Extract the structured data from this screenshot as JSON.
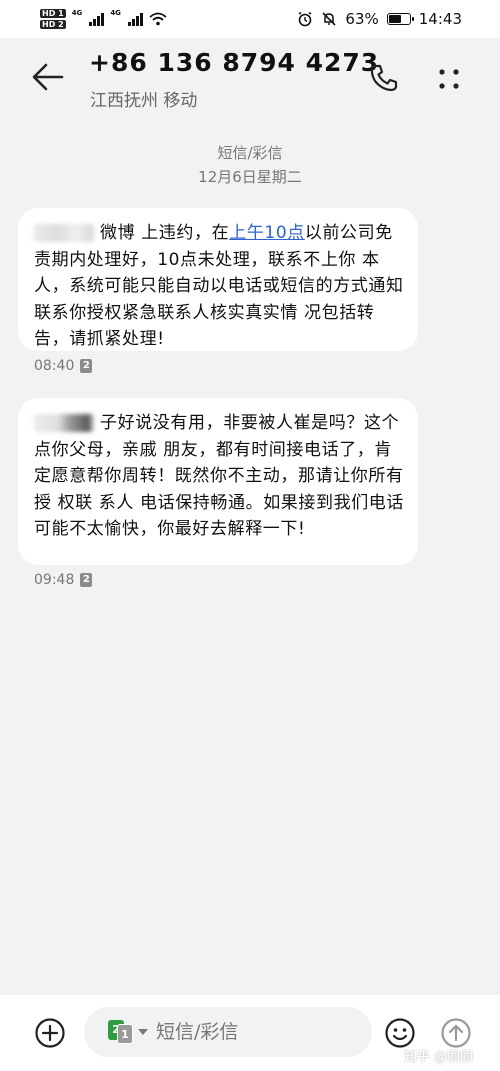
{
  "status_bar": {
    "hd_badge_1": "HD 1",
    "hd_badge_2": "HD 2",
    "network_1": "4G",
    "network_2": "4G",
    "battery_text": "63%",
    "battery_level": 0.63,
    "time": "14:43",
    "icons": [
      "hd-icon",
      "signal-icon",
      "wifi-icon",
      "alarm-icon",
      "mute-icon",
      "battery-icon"
    ]
  },
  "header": {
    "contact_number": "+86 136 8794 4273",
    "contact_location": "江西抚州 移动",
    "icons": [
      "back-arrow-icon",
      "phone-icon",
      "more-dots-icon"
    ]
  },
  "conversation": {
    "type_label": "短信/彩信",
    "date_label": "12月6日星期二"
  },
  "messages": [
    {
      "text_pre": "微博 上违约，在",
      "link": "上午10点",
      "text_post": "以前公司免责期内处理好，10点未处理，联系不上你 本人，系统可能只能自动以电话或短信的方式通知联系你授权紧急联系人核实真实情 况包括转告，请抓紧处理!",
      "time": "08:40",
      "sim": "2"
    },
    {
      "text_pre": "",
      "link": "",
      "text_post": "子好说没有用，非要被人崔是吗？这个点你父母，亲戚 朋友，都有时间接电话了，肯定愿意帮你周转！既然你不主动，那请让你所有授 权联 系人 电话保持畅通。如果接到我们电话可能不太愉快，你最好去解释一下!",
      "time": "09:48",
      "sim": "2"
    }
  ],
  "input_bar": {
    "placeholder": "短信/彩信",
    "sim_primary": "2",
    "sim_secondary": "1",
    "icons": [
      "add-icon",
      "sim-select-icon",
      "emoji-icon",
      "send-icon"
    ]
  },
  "watermark": "知乎 @圈圈"
}
